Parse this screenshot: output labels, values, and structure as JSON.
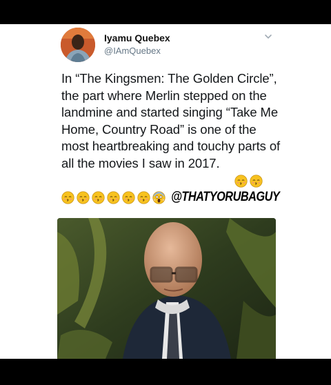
{
  "tweet": {
    "display_name": "Iyamu Quebex",
    "handle": "@IAmQuebex",
    "text": "In “The Kingsmen: The Golden Circle”, the part where Merlin stepped on the landmine and started singing “Take Me Home, Country Road” is one of the most heartbreaking and touchy parts of all the movies I saw in 2017.",
    "watermark": "@THATYORUBAGUY",
    "inline_emojis": [
      "kissing-face-closed-eyes-emoji",
      "kissing-face-closed-eyes-emoji"
    ],
    "row_emojis": [
      "kissing-face-closed-eyes-emoji",
      "kissing-face-closed-eyes-emoji",
      "kissing-face-closed-eyes-emoji",
      "kissing-face-closed-eyes-emoji",
      "kissing-face-closed-eyes-emoji",
      "kissing-face-closed-eyes-emoji",
      "face-screaming-in-fear-emoji"
    ],
    "menu_icon": "chevron-down-icon"
  },
  "colors": {
    "background": "#000000",
    "card": "#ffffff",
    "text": "#14171a",
    "handle": "#657786",
    "emoji_yellow": "#f7c21f"
  }
}
